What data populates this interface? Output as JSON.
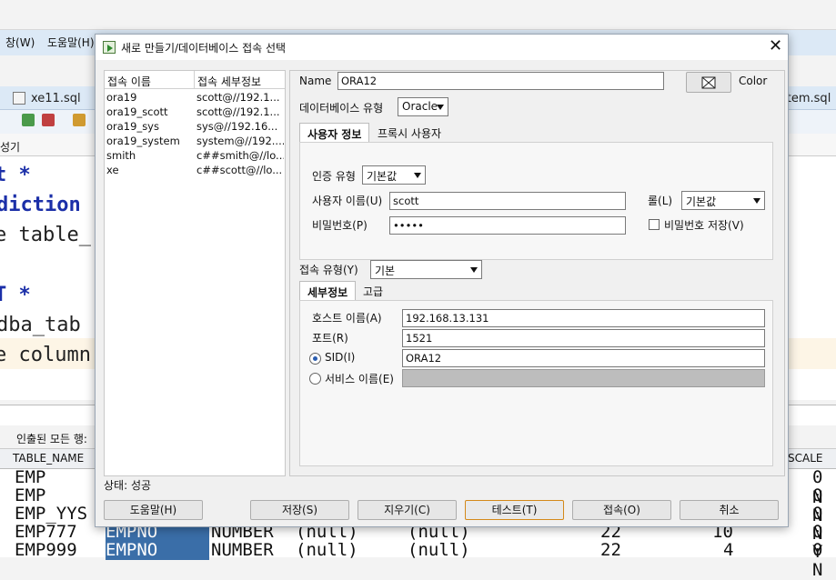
{
  "background": {
    "menu": [
      "창(W)",
      "도움말(H)"
    ],
    "tabs": [
      "xe11.sql",
      "stem.sql"
    ],
    "subtab": "성기",
    "code_lines": [
      "t *",
      "diction",
      "e table_",
      "T *",
      "dba_tab",
      "e column"
    ],
    "output_label": "인출된 모든 행:",
    "grid_headers": [
      "TABLE_NAME",
      "SCALE"
    ],
    "grid_rows": [
      {
        "c1": "EMP",
        "c2": "",
        "c3": "",
        "c4": "",
        "c5": "",
        "c6": "",
        "end": "0 N"
      },
      {
        "c1": "EMP",
        "c2": "",
        "c3": "",
        "c4": "",
        "c5": "",
        "c6": "",
        "end": "0 N"
      },
      {
        "c1": "EMP_YYS",
        "c2": "",
        "c3": "",
        "c4": "",
        "c5": "",
        "c6": "",
        "end": "0 N"
      },
      {
        "c1": "EMP777",
        "c2": "EMPNO",
        "c3": "NUMBER",
        "c4": "(null)",
        "c5": "(null)",
        "c6": "22",
        "c7": "10",
        "end": "0 Y"
      },
      {
        "c1": "EMP999",
        "c2": "EMPNO",
        "c3": "NUMBER",
        "c4": "(null)",
        "c5": "(null)",
        "c6": "22",
        "c7": "4",
        "end": "0 N"
      }
    ]
  },
  "dialog": {
    "title": "새로 만들기/데이터베이스 접속 선택",
    "list": {
      "headers": [
        "접속 이름",
        "접속 세부정보"
      ],
      "rows": [
        {
          "name": "ora19",
          "detail": "scott@//192.1..."
        },
        {
          "name": "ora19_scott",
          "detail": "scott@//192.1..."
        },
        {
          "name": "ora19_sys",
          "detail": "sys@//192.16..."
        },
        {
          "name": "ora19_system",
          "detail": "system@//192...."
        },
        {
          "name": "smith",
          "detail": "c##smith@//lo..."
        },
        {
          "name": "xe",
          "detail": "c##scott@//lo..."
        }
      ]
    },
    "status": "상태: 성공",
    "name_label": "Name",
    "name_value": "ORA12",
    "color_label": "Color",
    "db_type_label": "데이터베이스 유형",
    "db_type_value": "Oracle",
    "tabs": [
      "사용자 정보",
      "프록시 사용자"
    ],
    "auth_type_label": "인증 유형",
    "auth_type_value": "기본값",
    "username_label": "사용자 이름(U)",
    "username_value": "scott",
    "role_label": "롤(L)",
    "role_value": "기본값",
    "password_label": "비밀번호(P)",
    "password_value": "•••••",
    "save_password_label": "비밀번호 저장(V)",
    "conn_type_label": "접속 유형(Y)",
    "conn_type_value": "기본",
    "detail_tabs": [
      "세부정보",
      "고급"
    ],
    "host_label": "호스트 이름(A)",
    "host_value": "192.168.13.131",
    "port_label": "포트(R)",
    "port_value": "1521",
    "sid_label": "SID(I)",
    "sid_value": "ORA12",
    "service_label": "서비스 이름(E)",
    "buttons": {
      "help": "도움말(H)",
      "save": "저장(S)",
      "clear": "지우기(C)",
      "test": "테스트(T)",
      "connect": "접속(O)",
      "cancel": "취소"
    }
  }
}
